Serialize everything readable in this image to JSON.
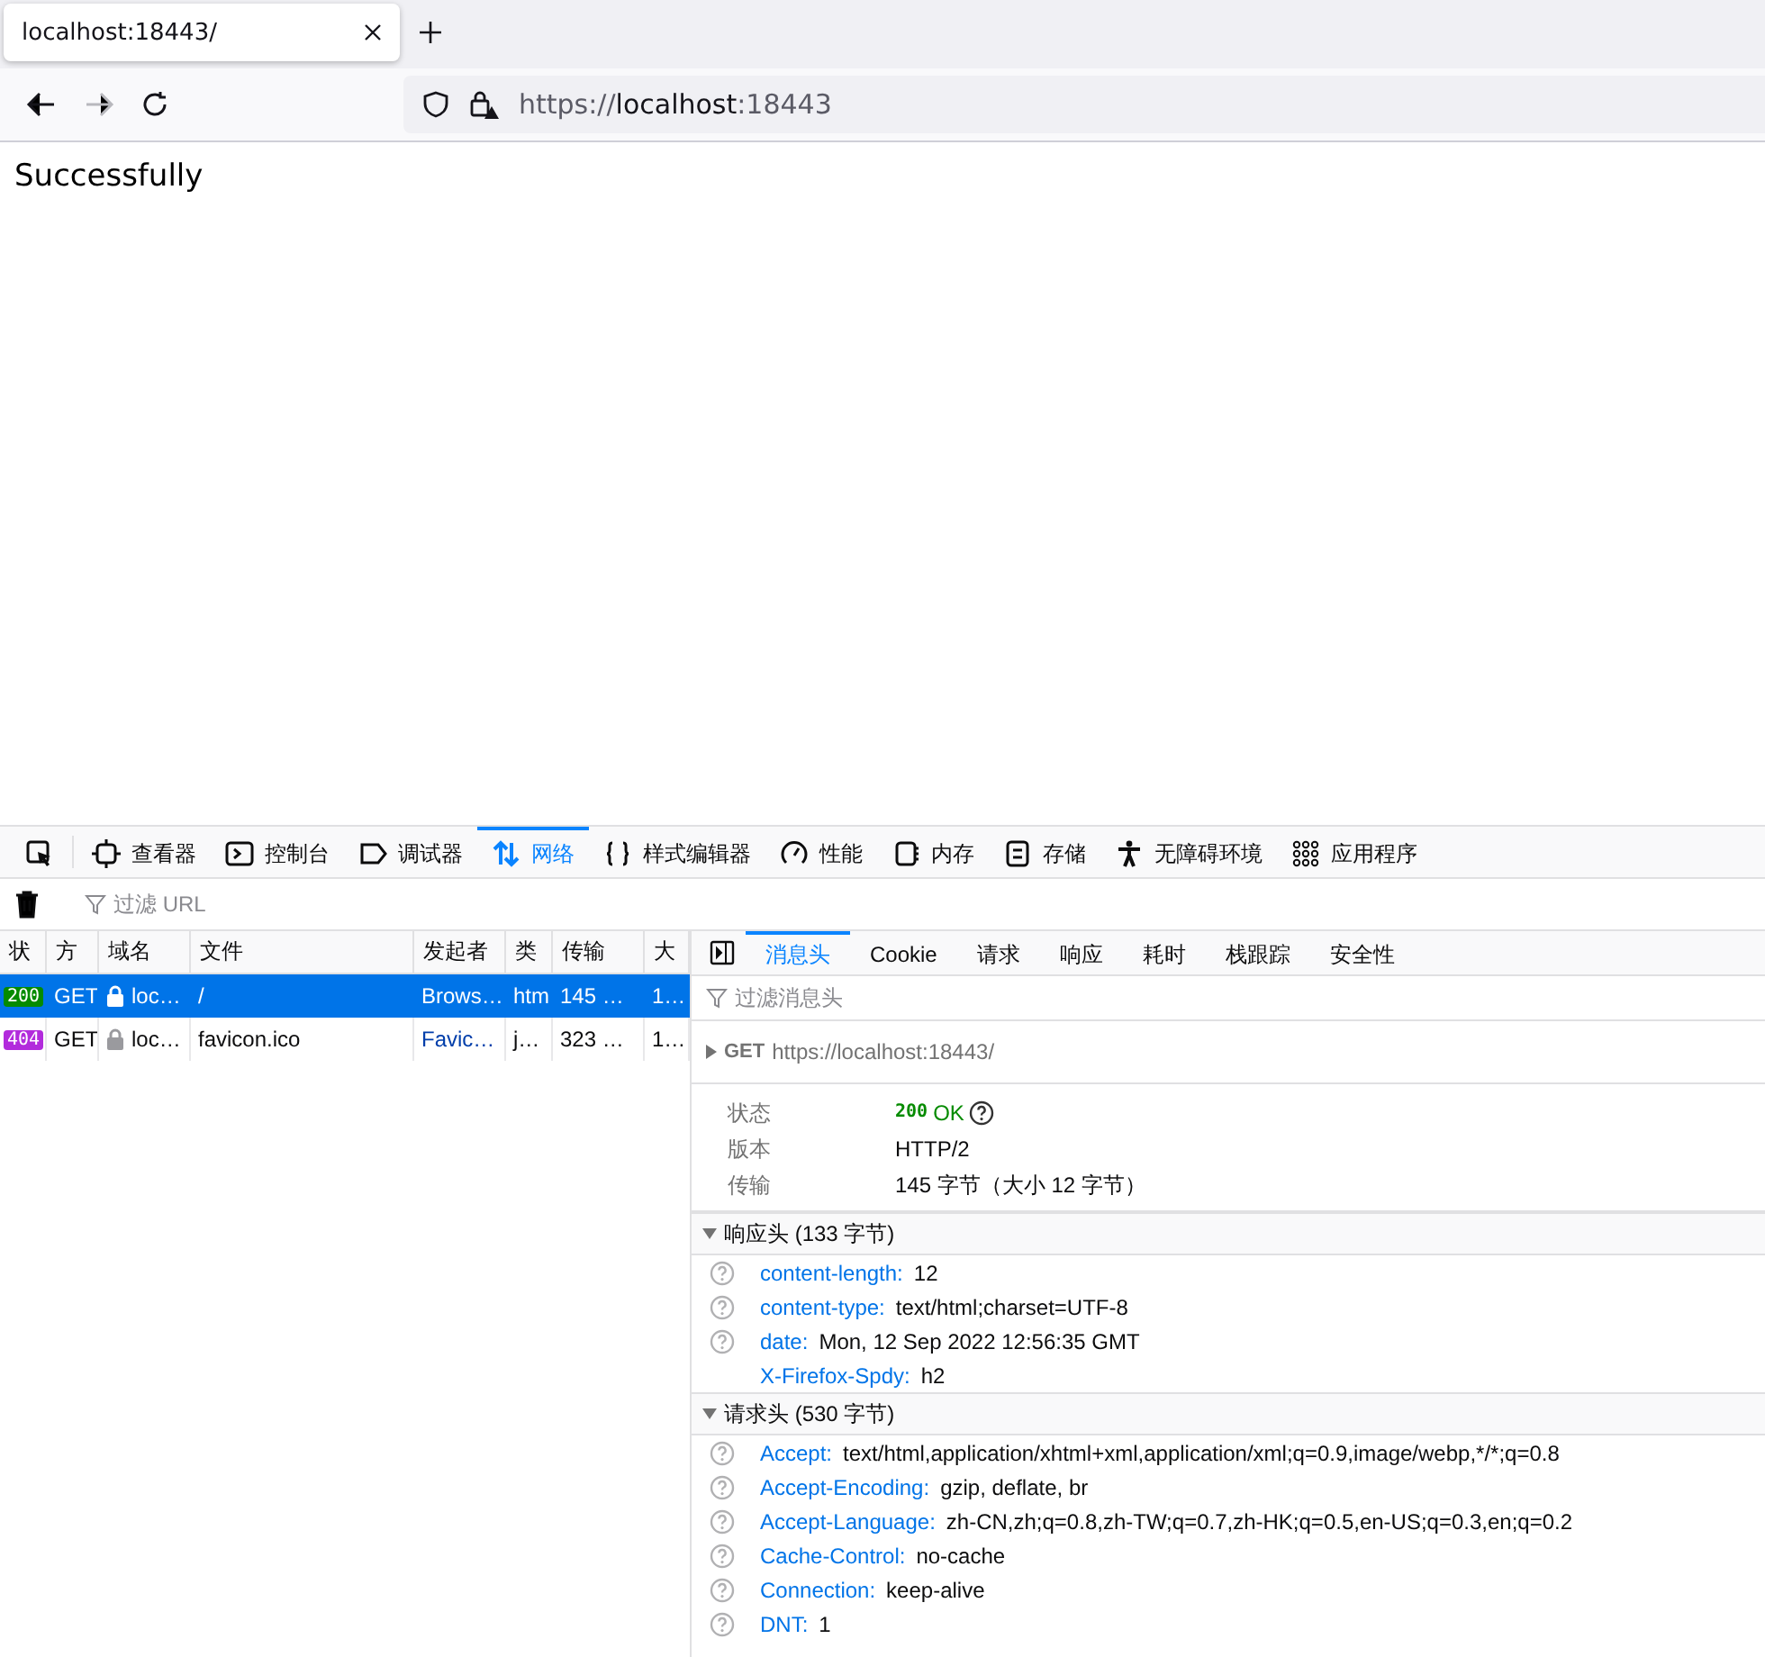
{
  "browser_tab": {
    "title": "localhost:18443/",
    "selected": true
  },
  "nav": {
    "url_scheme": "https://",
    "url_host": "localhost",
    "url_port": ":18443"
  },
  "page": {
    "text": "Successfully"
  },
  "devtools": {
    "tools": [
      {
        "kind": "picker",
        "selected": false
      },
      {
        "kind": "inspector",
        "label": "查看器",
        "selected": false
      },
      {
        "kind": "console",
        "label": "控制台",
        "selected": false
      },
      {
        "kind": "debugger",
        "label": "调试器",
        "selected": false
      },
      {
        "kind": "network",
        "label": "网络",
        "selected": true
      },
      {
        "kind": "style",
        "label": "样式编辑器",
        "selected": false
      },
      {
        "kind": "performance",
        "label": "性能",
        "selected": false
      },
      {
        "kind": "memory",
        "label": "内存",
        "selected": false
      },
      {
        "kind": "storage",
        "label": "存储",
        "selected": false
      },
      {
        "kind": "accessibility",
        "label": "无障碍环境",
        "selected": false
      },
      {
        "kind": "application",
        "label": "应用程序",
        "selected": false
      }
    ],
    "filter": {
      "placeholder": "过滤 URL"
    },
    "requests": {
      "columns": [
        "状",
        "方",
        "域名",
        "文件",
        "发起者",
        "类",
        "传输",
        "大"
      ],
      "rows": [
        {
          "status": "200",
          "color": "#058b00",
          "method": "GET",
          "domain": "loc…",
          "file": "/",
          "initiator": "Brows…",
          "type": "htm",
          "transferred": "145 …",
          "size": "1…",
          "selected": true
        },
        {
          "status": "404",
          "color": "#b22bdc",
          "method": "GET",
          "domain": "loc…",
          "file": "favicon.ico",
          "initiator": "Favic…",
          "type": "j…",
          "transferred": "323 …",
          "size": "1…",
          "selected": false
        }
      ]
    },
    "details": {
      "tabs": [
        {
          "label": "消息头",
          "selected": true
        },
        {
          "label": "Cookie",
          "selected": false
        },
        {
          "label": "请求",
          "selected": false
        },
        {
          "label": "响应",
          "selected": false
        },
        {
          "label": "耗时",
          "selected": false
        },
        {
          "label": "栈跟踪",
          "selected": false
        },
        {
          "label": "安全性",
          "selected": false
        }
      ],
      "filter": {
        "placeholder": "过滤消息头"
      },
      "method": "GET",
      "url": "https://localhost:18443/",
      "summary": [
        {
          "kind": "status",
          "label": "状态",
          "code": "200",
          "text": "OK"
        },
        {
          "kind": "text",
          "label": "版本",
          "value": "HTTP/2"
        },
        {
          "kind": "text",
          "label": "传输",
          "value": "145 字节（大小 12 字节）"
        }
      ],
      "sections": [
        {
          "title": "响应头 (133 字节)",
          "expanded": true,
          "headers": [
            {
              "name": "content-length:",
              "value": "12",
              "help": true
            },
            {
              "name": "content-type:",
              "value": "text/html;charset=UTF-8",
              "help": true
            },
            {
              "name": "date:",
              "value": "Mon, 12 Sep 2022 12:56:35 GMT",
              "help": true
            },
            {
              "name": "X-Firefox-Spdy:",
              "value": "h2",
              "help": false
            }
          ]
        },
        {
          "title": "请求头 (530 字节)",
          "expanded": true,
          "headers": [
            {
              "name": "Accept:",
              "value": "text/html,application/xhtml+xml,application/xml;q=0.9,image/webp,*/*;q=0.8",
              "help": true
            },
            {
              "name": "Accept-Encoding:",
              "value": "gzip, deflate, br",
              "help": true
            },
            {
              "name": "Accept-Language:",
              "value": "zh-CN,zh;q=0.8,zh-TW;q=0.7,zh-HK;q=0.5,en-US;q=0.3,en;q=0.2",
              "help": true
            },
            {
              "name": "Cache-Control:",
              "value": "no-cache",
              "help": true
            },
            {
              "name": "Connection:",
              "value": "keep-alive",
              "help": true
            },
            {
              "name": "DNT:",
              "value": "1",
              "help": true
            }
          ]
        }
      ]
    }
  }
}
